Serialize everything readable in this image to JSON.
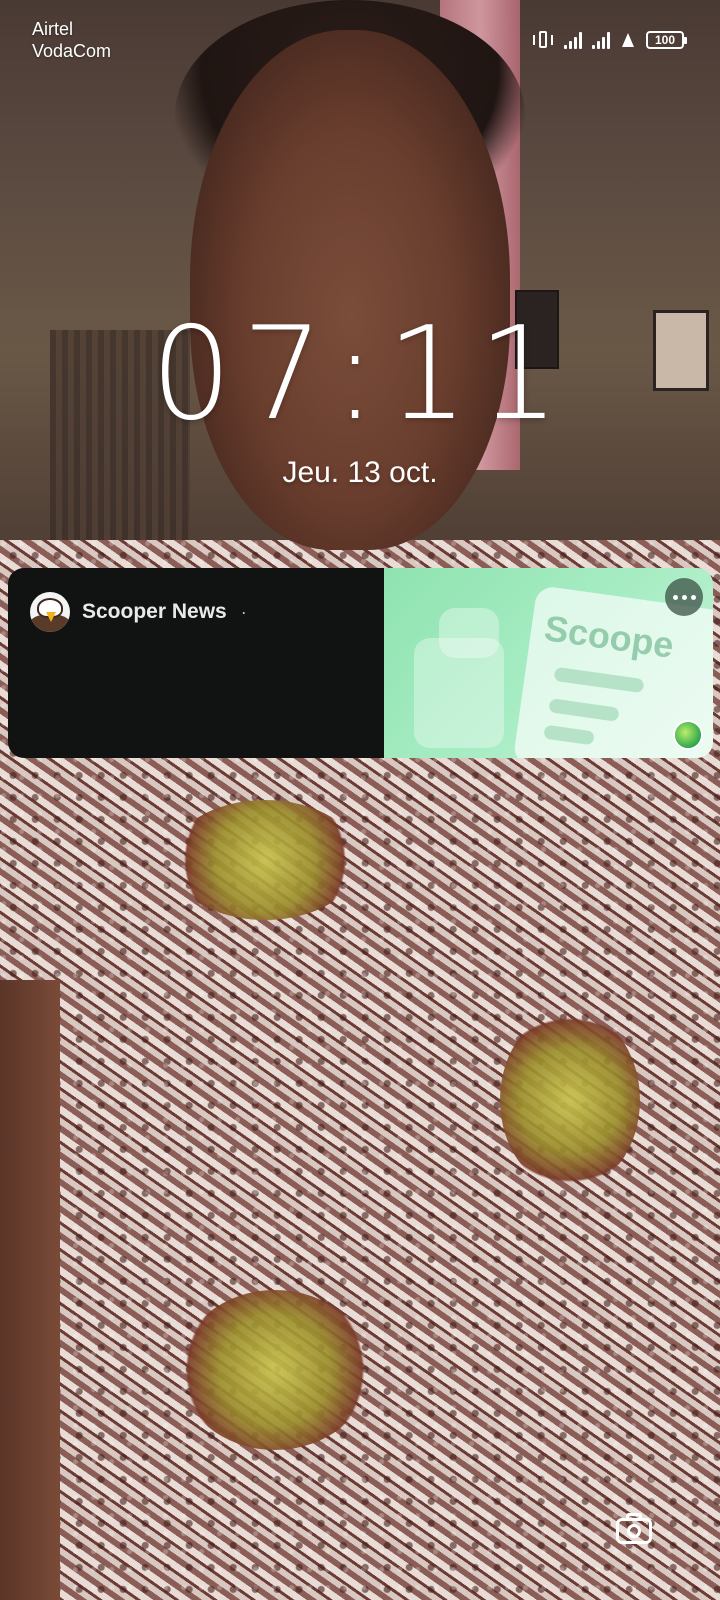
{
  "status_bar": {
    "carrier_1": "Airtel",
    "carrier_2": "VodaCom",
    "battery_level": "100",
    "icons": [
      "vibrate-icon",
      "signal-icon",
      "signal-icon",
      "flask-icon",
      "battery-icon"
    ]
  },
  "lockscreen": {
    "time": "07:11",
    "date": "Jeu. 13 oct."
  },
  "notification": {
    "app_name": "Scooper News",
    "separator": "·",
    "preview_title": "Scoope",
    "accent_color": "#8fe3b0",
    "icons": [
      "eagle-app-icon",
      "more-options-icon",
      "green-badge-icon"
    ]
  },
  "shortcuts": {
    "camera_icon": "camera-icon"
  }
}
